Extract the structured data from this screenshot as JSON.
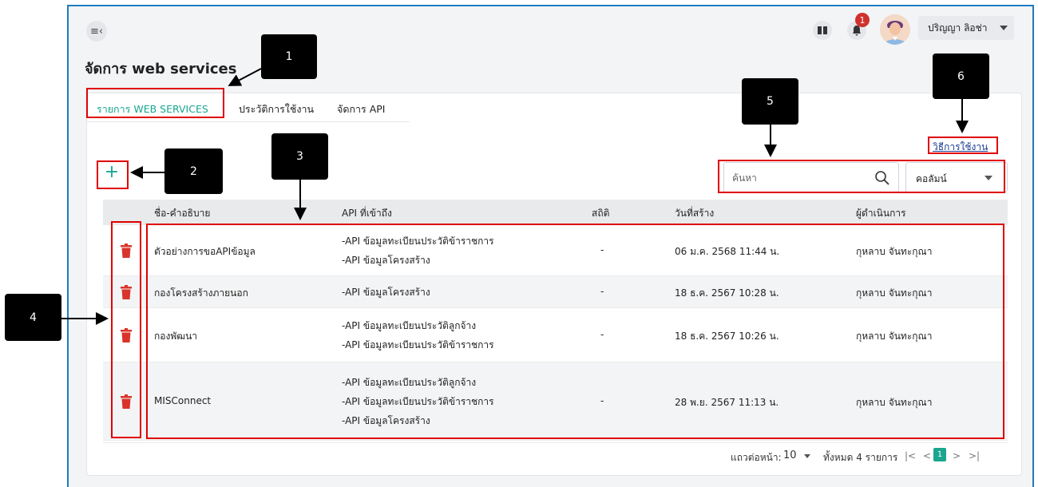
{
  "header": {
    "menu_toggle_glyph": "≡‹",
    "notification_count": "1",
    "user_name": "ปริญญา ลิอช่า"
  },
  "page": {
    "title": "จัดการ web services"
  },
  "tabs": [
    {
      "label": "รายการ WEB SERVICES",
      "active": true
    },
    {
      "label": "ประวัติการใช้งาน",
      "active": false
    },
    {
      "label": "จัดการ API",
      "active": false
    }
  ],
  "toolbar": {
    "howto_label": "วิธีการใช้งาน",
    "add_glyph": "+",
    "search_placeholder": "ค้นหา",
    "column_select_value": "คอลัมน์"
  },
  "table": {
    "headers": [
      "ชื่อ-คำอธิบาย",
      "API ที่เข้าถึง",
      "สถิติ",
      "วันที่สร้าง",
      "ผู้ดำเนินการ"
    ],
    "rows": [
      {
        "name": "ตัวอย่างการขอAPIข้อมูล",
        "apis": [
          "-API ข้อมูลทะเบียนประวัติข้าราชการ",
          "-API ข้อมูลโครงสร้าง"
        ],
        "stats": "-",
        "created": "06 ม.ค. 2568 11:44 น.",
        "operator": "กุหลาบ จันทะกุณา"
      },
      {
        "name": "กองโครงสร้างภายนอก",
        "apis": [
          "-API ข้อมูลโครงสร้าง"
        ],
        "stats": "-",
        "created": "18 ธ.ค. 2567 10:28 น.",
        "operator": "กุหลาบ จันทะกุณา"
      },
      {
        "name": "กองพัฒนา",
        "apis": [
          "-API ข้อมูลทะเบียนประวัติลูกจ้าง",
          "-API ข้อมูลทะเบียนประวัติข้าราชการ"
        ],
        "stats": "-",
        "created": "18 ธ.ค. 2567 10:26 น.",
        "operator": "กุหลาบ จันทะกุณา"
      },
      {
        "name": "MISConnect",
        "apis": [
          "-API ข้อมูลทะเบียนประวัติลูกจ้าง",
          "-API ข้อมูลทะเบียนประวัติข้าราชการ",
          "-API ข้อมูลโครงสร้าง"
        ],
        "stats": "-",
        "created": "28 พ.ย. 2567 11:13 น.",
        "operator": "กุหลาบ จันทะกุณา"
      }
    ]
  },
  "pagination": {
    "rows_per_page_label": "แถวต่อหน้า:",
    "rows_per_page_value": "10",
    "total_label": "ทั้งหมด 4 รายการ",
    "first": "|<",
    "prev": "<",
    "current_page": "1",
    "next": ">",
    "last": ">|"
  },
  "annotations": [
    "1",
    "2",
    "3",
    "4",
    "5",
    "6"
  ],
  "colors": {
    "accent": "#1aa58f",
    "annotation_red": "#e00000",
    "delete_red": "#d9342b",
    "frame_blue": "#1f7bc1"
  }
}
